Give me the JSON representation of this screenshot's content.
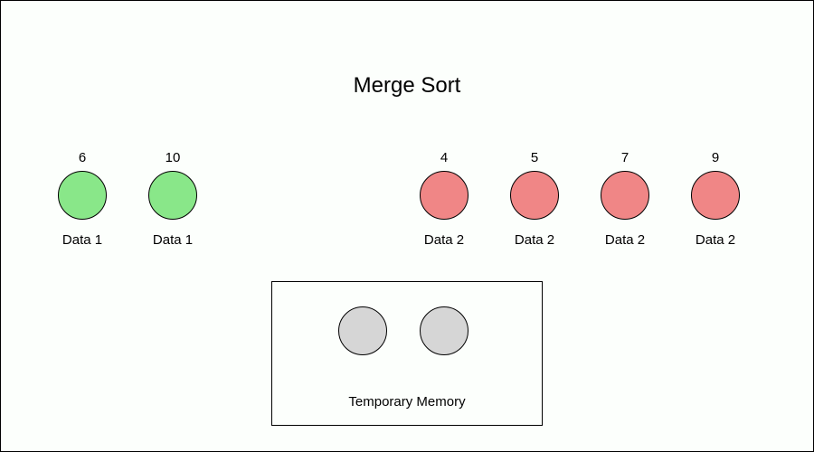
{
  "title": "Merge Sort",
  "group1": {
    "label": "Data 1",
    "color": "green",
    "items": [
      {
        "value": "6"
      },
      {
        "value": "10"
      }
    ]
  },
  "group2": {
    "label": "Data 2",
    "color": "red",
    "items": [
      {
        "value": "4"
      },
      {
        "value": "5"
      },
      {
        "value": "7"
      },
      {
        "value": "9"
      }
    ]
  },
  "temp": {
    "label": "Temporary Memory",
    "slots": 2
  }
}
